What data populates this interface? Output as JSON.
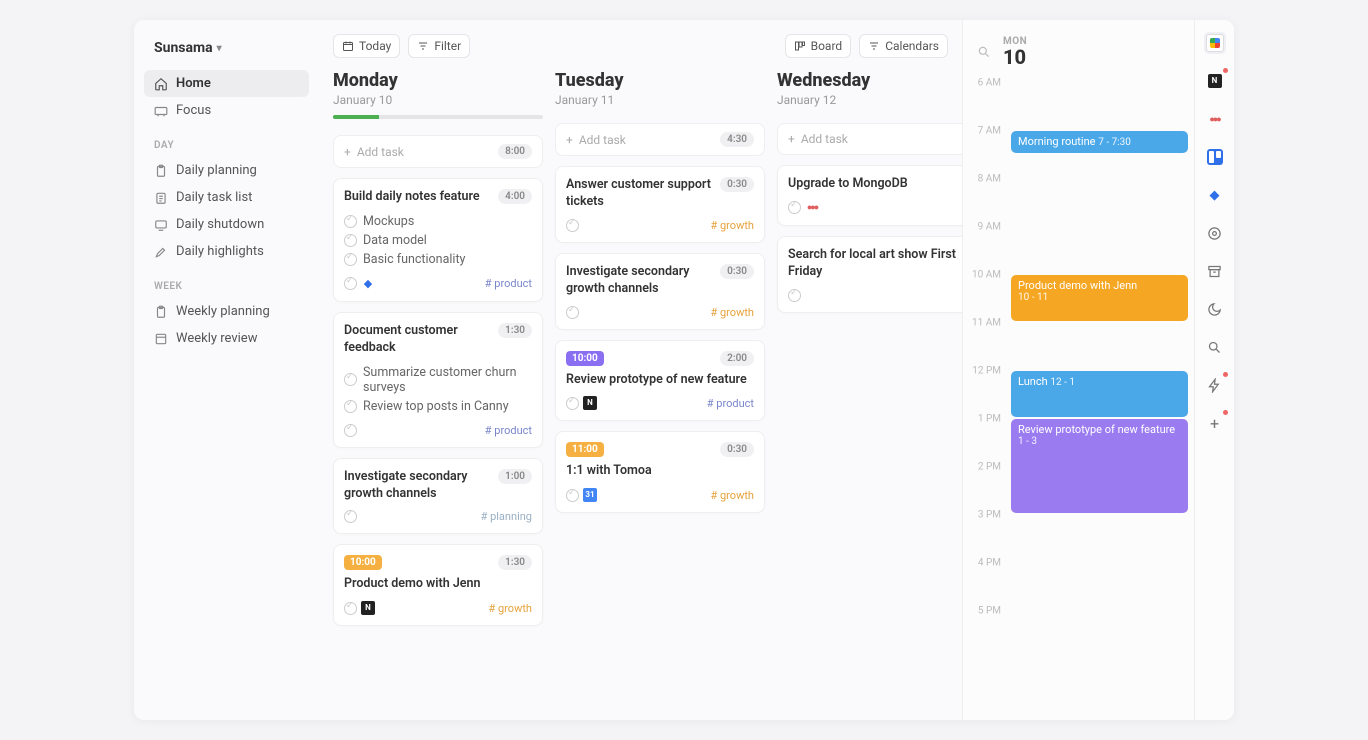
{
  "workspace": {
    "name": "Sunsama"
  },
  "sidebar": {
    "nav": [
      {
        "label": "Home",
        "icon": "home"
      },
      {
        "label": "Focus",
        "icon": "focus"
      }
    ],
    "sections": [
      {
        "title": "DAY",
        "items": [
          {
            "label": "Daily planning",
            "icon": "clipboard"
          },
          {
            "label": "Daily task list",
            "icon": "list"
          },
          {
            "label": "Daily shutdown",
            "icon": "shutdown"
          },
          {
            "label": "Daily highlights",
            "icon": "highlight"
          }
        ]
      },
      {
        "title": "WEEK",
        "items": [
          {
            "label": "Weekly planning",
            "icon": "clipboard"
          },
          {
            "label": "Weekly review",
            "icon": "review"
          }
        ]
      }
    ]
  },
  "topbar": {
    "today": "Today",
    "filter": "Filter",
    "board": "Board",
    "calendars": "Calendars"
  },
  "columns": [
    {
      "day": "Monday",
      "date": "January 10",
      "progress": 22,
      "add": {
        "label": "Add task",
        "total": "8:00"
      },
      "cards": [
        {
          "title": "Build daily notes feature",
          "duration": "4:00",
          "subtasks": [
            "Mockups",
            "Data model",
            "Basic functionality"
          ],
          "integration": "diamond",
          "tag": "product"
        },
        {
          "title": "Document customer feedback",
          "duration": "1:30",
          "subtasks": [
            "Summarize customer churn surveys",
            "Review top posts in Canny"
          ],
          "tag": "product"
        },
        {
          "title": "Investigate secondary growth channels",
          "duration": "1:00",
          "tag": "planning"
        },
        {
          "time_badge": "10:00",
          "badge_color": "orange",
          "title": "Product demo with Jenn",
          "duration": "1:30",
          "integration": "notion",
          "tag": "growth"
        }
      ]
    },
    {
      "day": "Tuesday",
      "date": "January 11",
      "add": {
        "label": "Add task",
        "total": "4:30"
      },
      "cards": [
        {
          "title": "Answer customer support tickets",
          "duration": "0:30",
          "tag": "growth"
        },
        {
          "title": "Investigate secondary growth channels",
          "duration": "0:30",
          "tag": "growth"
        },
        {
          "time_badge": "10:00",
          "badge_color": "purple",
          "title": "Review prototype of new feature",
          "duration": "2:00",
          "integration": "notion",
          "tag": "product"
        },
        {
          "time_badge": "11:00",
          "badge_color": "orange",
          "title": "1:1 with Tomoa",
          "duration": "0:30",
          "integration": "gcal",
          "tag": "growth"
        }
      ]
    },
    {
      "day": "Wednesday",
      "date": "January 12",
      "add": {
        "label": "Add task"
      },
      "cards": [
        {
          "title": "Upgrade to MongoDB",
          "integration": "asana"
        },
        {
          "title": "Search for local art show First Friday"
        }
      ]
    }
  ],
  "calendar": {
    "dow": "MON",
    "daynum": "10",
    "hours": [
      "6 AM",
      "7 AM",
      "8 AM",
      "9 AM",
      "10 AM",
      "11 AM",
      "12 PM",
      "1 PM",
      "2 PM",
      "3 PM",
      "4 PM",
      "5 PM"
    ],
    "events": [
      {
        "title": "Morning routine",
        "sub": "7 - 7:30",
        "color": "blue",
        "start": 7,
        "end": 7.5,
        "inline": true
      },
      {
        "title": "Product demo with Jenn",
        "sub": "10 - 11",
        "color": "orange",
        "start": 10,
        "end": 11
      },
      {
        "title": "Lunch",
        "sub": "12 - 1",
        "color": "blue",
        "start": 12,
        "end": 13,
        "inline": true
      },
      {
        "title": "Review prototype of new feature",
        "sub": "1 - 3",
        "color": "purple",
        "start": 13,
        "end": 15
      }
    ]
  },
  "rail": [
    {
      "name": "gcal",
      "active": true
    },
    {
      "name": "notion",
      "dot": true
    },
    {
      "name": "asana"
    },
    {
      "name": "trello"
    },
    {
      "name": "jira"
    },
    {
      "name": "settings"
    },
    {
      "name": "archive"
    },
    {
      "name": "moon"
    },
    {
      "name": "search"
    },
    {
      "name": "lightning",
      "dot": true
    },
    {
      "name": "plus",
      "dot": true
    }
  ]
}
